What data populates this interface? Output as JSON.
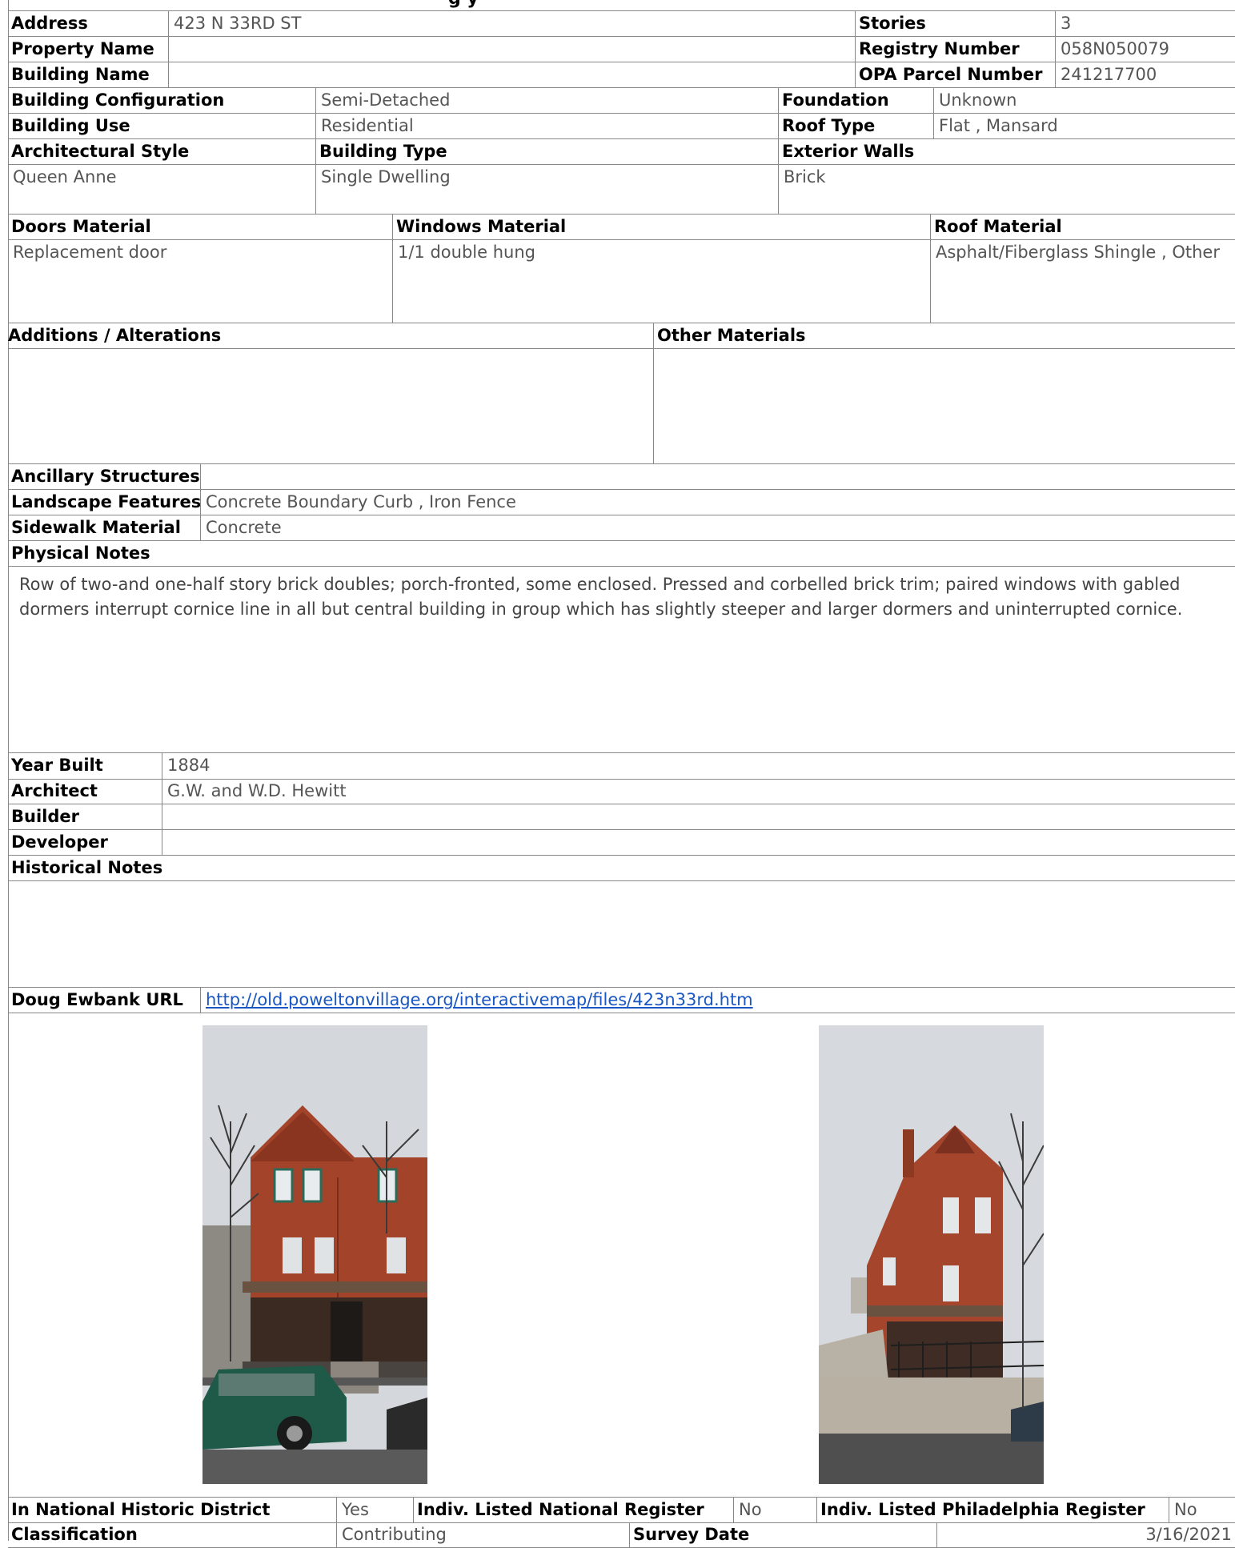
{
  "page": {
    "title_fragment": "g                                  y"
  },
  "header": {
    "address_label": "Address",
    "address_value": "423 N 33RD ST",
    "property_name_label": "Property Name",
    "property_name_value": "",
    "building_name_label": "Building Name",
    "building_name_value": "",
    "stories_label": "Stories",
    "stories_value": "3",
    "registry_label": "Registry Number",
    "registry_value": "058N050079",
    "opa_label": "OPA Parcel Number",
    "opa_value": "241217700"
  },
  "building": {
    "config_label": "Building Configuration",
    "config_value": "Semi-Detached",
    "use_label": "Building Use",
    "use_value": "Residential",
    "foundation_label": "Foundation",
    "foundation_value": "Unknown",
    "roof_type_label": "Roof Type",
    "roof_type_value": "Flat , Mansard",
    "style_label": "Architectural Style",
    "style_value": "Queen Anne",
    "type_label": "Building Type",
    "type_value": "Single Dwelling",
    "walls_label": "Exterior Walls",
    "walls_value": "Brick"
  },
  "materials": {
    "doors_label": "Doors Material",
    "doors_value": "Replacement door",
    "windows_label": "Windows Material",
    "windows_value": "1/1 double hung",
    "roof_label": "Roof Material",
    "roof_value": "Asphalt/Fiberglass Shingle , Other"
  },
  "alterations": {
    "additions_label": "Additions / Alterations",
    "additions_value": "",
    "other_label": "Other Materials",
    "other_value": ""
  },
  "site": {
    "ancillary_label": "Ancillary Structures",
    "ancillary_value": "",
    "landscape_label": "Landscape Features",
    "landscape_value": "Concrete Boundary Curb , Iron Fence",
    "sidewalk_label": "Sidewalk Material",
    "sidewalk_value": "Concrete",
    "physical_notes_label": "Physical Notes",
    "physical_notes_text": "Row of two-and one-half story brick doubles; porch-fronted, some enclosed. Pressed and corbelled brick trim; paired windows with gabled dormers interrupt cornice line in all but central building in group which has slightly steeper and larger dormers and uninterrupted cornice."
  },
  "history": {
    "year_label": "Year Built",
    "year_value": "1884",
    "architect_label": "Architect",
    "architect_value": "G.W. and W.D. Hewitt",
    "builder_label": "Builder",
    "builder_value": "",
    "developer_label": "Developer",
    "developer_value": "",
    "historical_notes_label": "Historical Notes",
    "historical_notes_text": ""
  },
  "ewbank": {
    "label": "Doug Ewbank URL",
    "url": "http://old.poweltonvillage.org/interactivemap/files/423n33rd.htm"
  },
  "footer": {
    "district_label": "In National Historic District",
    "district_value": "Yes",
    "natl_register_label": "Indiv. Listed National Register",
    "natl_register_value": "No",
    "phila_register_label": "Indiv. Listed Philadelphia Register",
    "phila_register_value": "No",
    "classification_label": "Classification",
    "classification_value": "Contributing",
    "survey_label": "Survey Date",
    "survey_value": "3/16/2021"
  },
  "colors": {
    "rule": "#888888",
    "label_text": "#000000",
    "value_text": "#555555",
    "link": "#1a57c4",
    "brick": "#a4432b",
    "sky": "#cfd3d8"
  }
}
